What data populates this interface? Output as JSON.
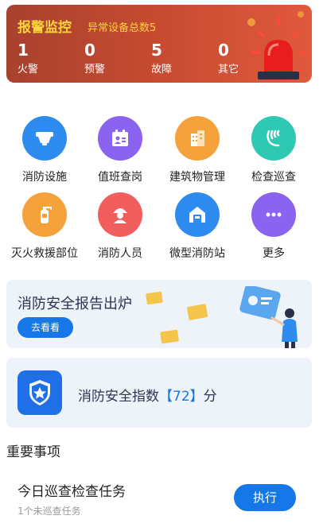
{
  "alarm": {
    "title": "报警监控",
    "subtitle": "异常设备总数5",
    "stats": [
      {
        "value": "1",
        "label": "火警"
      },
      {
        "value": "0",
        "label": "预警"
      },
      {
        "value": "5",
        "label": "故障"
      },
      {
        "value": "0",
        "label": "其它"
      }
    ]
  },
  "grid": [
    {
      "label": "消防设施",
      "icon": "smoke-detector-icon",
      "color": "#2e8bf0"
    },
    {
      "label": "值班查岗",
      "icon": "duty-roster-icon",
      "color": "#8a63f0"
    },
    {
      "label": "建筑物管理",
      "icon": "building-icon",
      "color": "#f6a23a"
    },
    {
      "label": "检查巡查",
      "icon": "patrol-icon",
      "color": "#2ec8b3"
    },
    {
      "label": "灭火救援部位",
      "icon": "extinguisher-icon",
      "color": "#f6a23a"
    },
    {
      "label": "消防人员",
      "icon": "firefighter-icon",
      "color": "#f25e5e"
    },
    {
      "label": "微型消防站",
      "icon": "fire-station-icon",
      "color": "#2e8bf0"
    },
    {
      "label": "更多",
      "icon": "more-icon",
      "color": "#8a63f0"
    }
  ],
  "report": {
    "title": "消防安全报告出炉",
    "button": "去看看"
  },
  "index": {
    "prefix": "消防安全指数",
    "score": "【72】",
    "suffix": "分"
  },
  "important": {
    "title": "重要事项",
    "task_title": "今日巡查检查任务",
    "task_sub": "1个未巡查任务",
    "exec_button": "执行"
  }
}
